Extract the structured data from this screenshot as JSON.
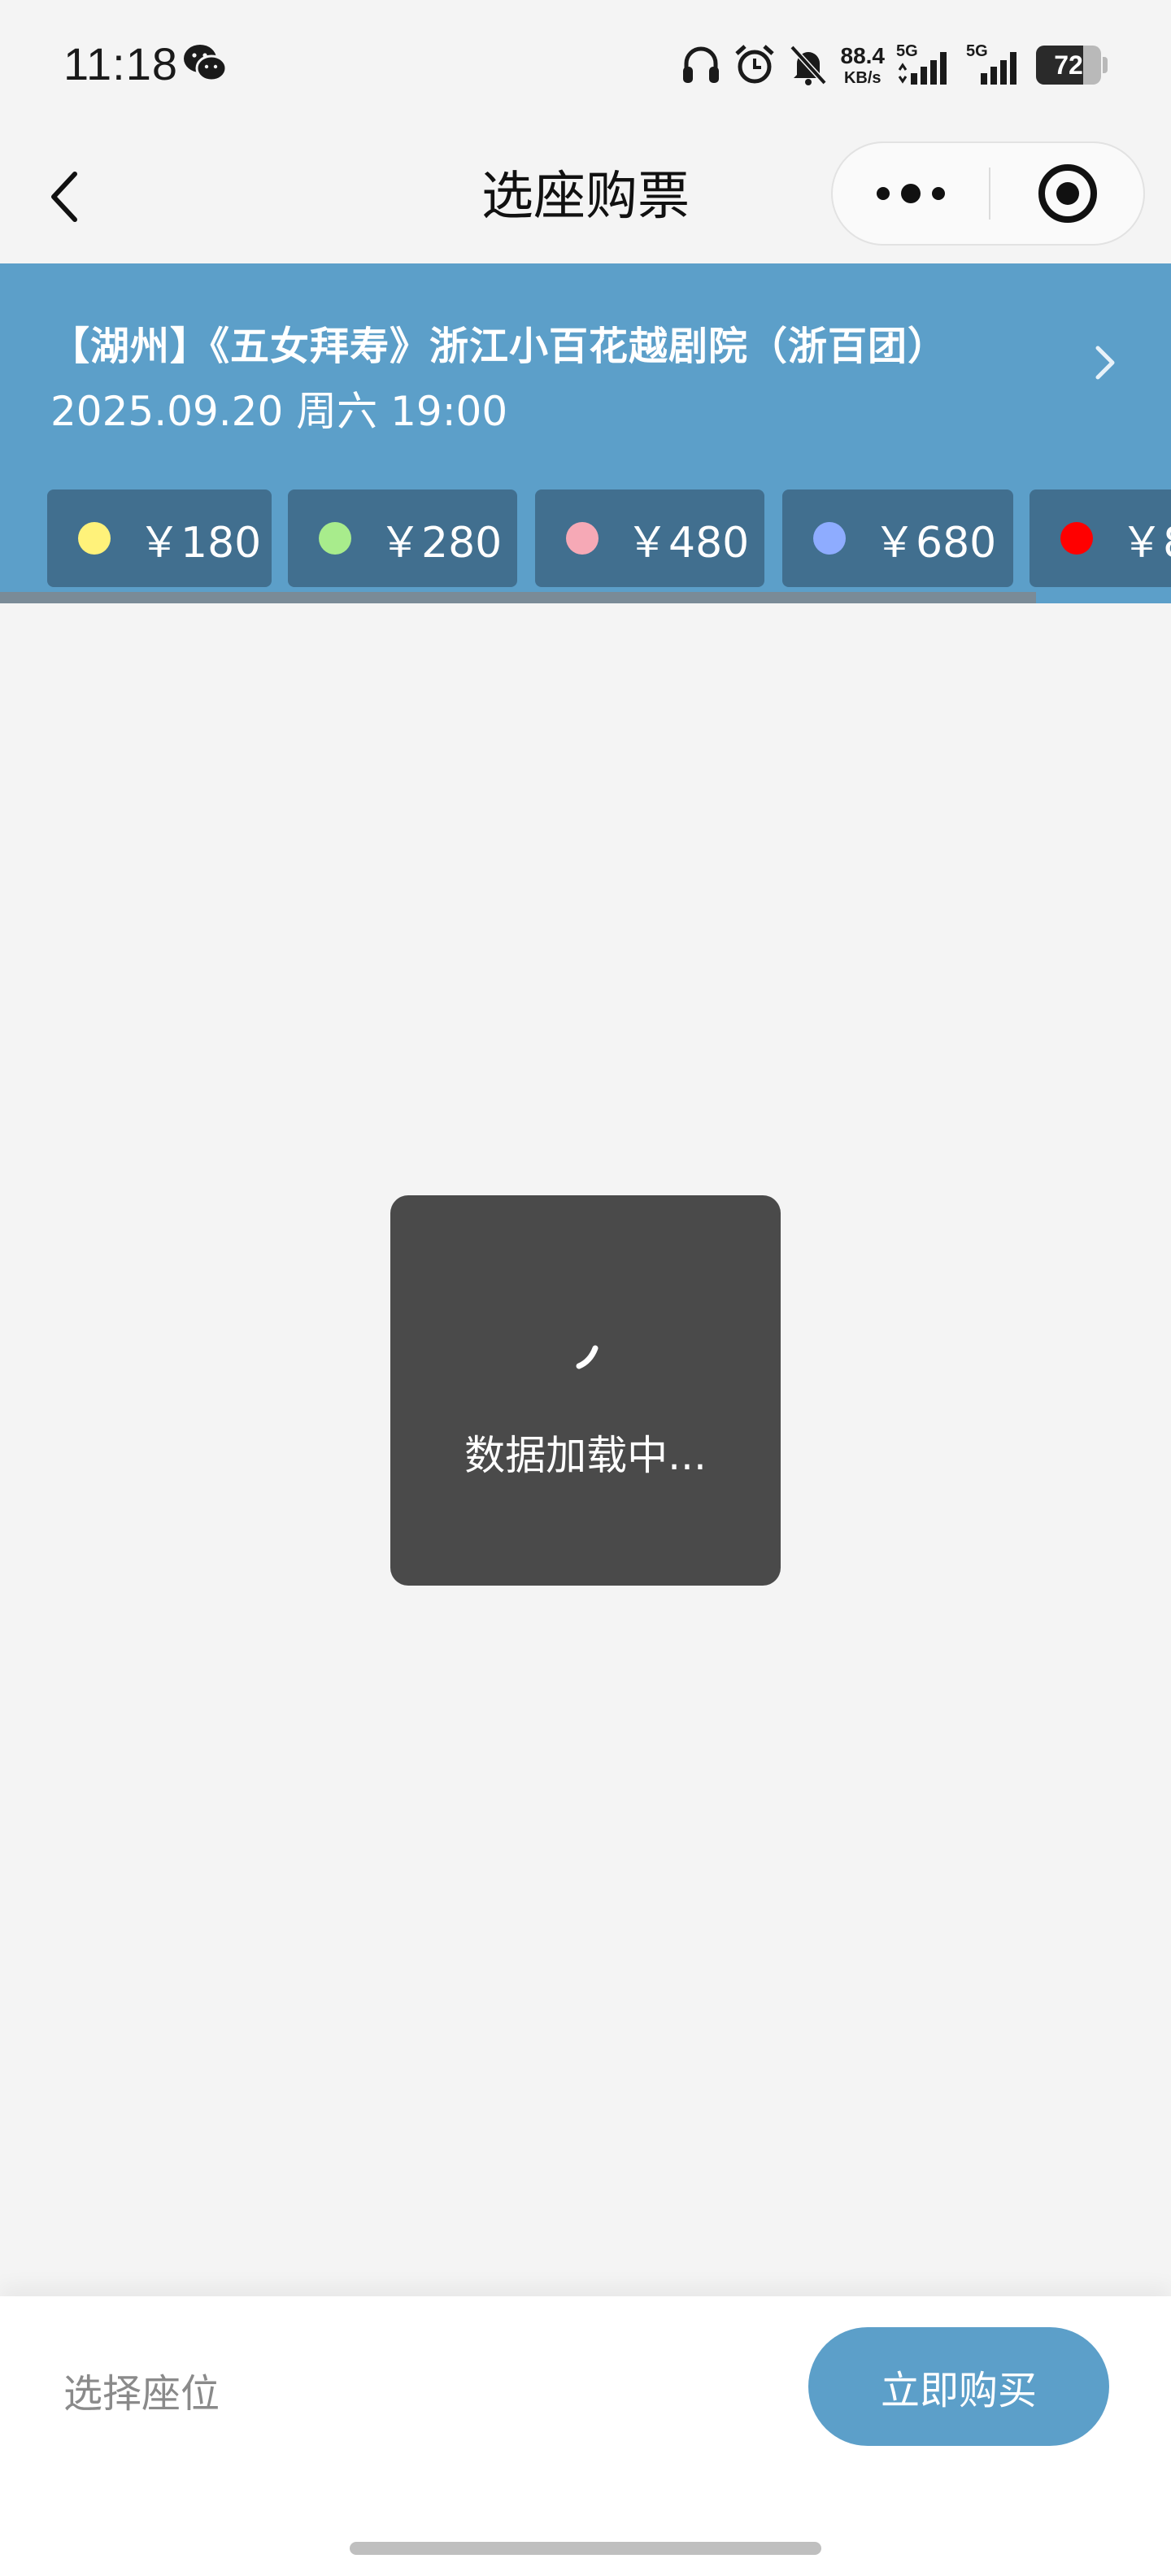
{
  "status_bar": {
    "time": "11:18",
    "net_speed_value": "88.4",
    "net_speed_unit": "KB/s",
    "sim1_label": "5G",
    "sim2_label": "5G",
    "battery_level": "72",
    "battery_fraction": 0.72,
    "icons": [
      "wechat-icon",
      "headphones-icon",
      "alarm-icon",
      "mute-bell-icon",
      "signal-icon",
      "battery-icon"
    ]
  },
  "nav": {
    "title": "选座购票"
  },
  "event": {
    "title": "【湖州】《五女拜寿》浙江小百花越剧院（浙百团）",
    "date": "2025.09.20 周六 19:00"
  },
  "prices": [
    {
      "label": "￥180",
      "color": "#fff27a"
    },
    {
      "label": "￥280",
      "color": "#a8ec8c"
    },
    {
      "label": "￥480",
      "color": "#f6a9b6"
    },
    {
      "label": "￥680",
      "color": "#8eacff"
    },
    {
      "label": "￥8",
      "color": "#ff0000"
    }
  ],
  "price_strip_scroll_fraction": 0.885,
  "loading": {
    "text": "数据加载中..."
  },
  "bottom": {
    "seat_hint": "选择座位",
    "buy_label": "立即购买"
  },
  "colors": {
    "accent": "#5c9fc9",
    "price_tag_bg": "#416f8f",
    "toast_bg": "#4a4a4a"
  }
}
